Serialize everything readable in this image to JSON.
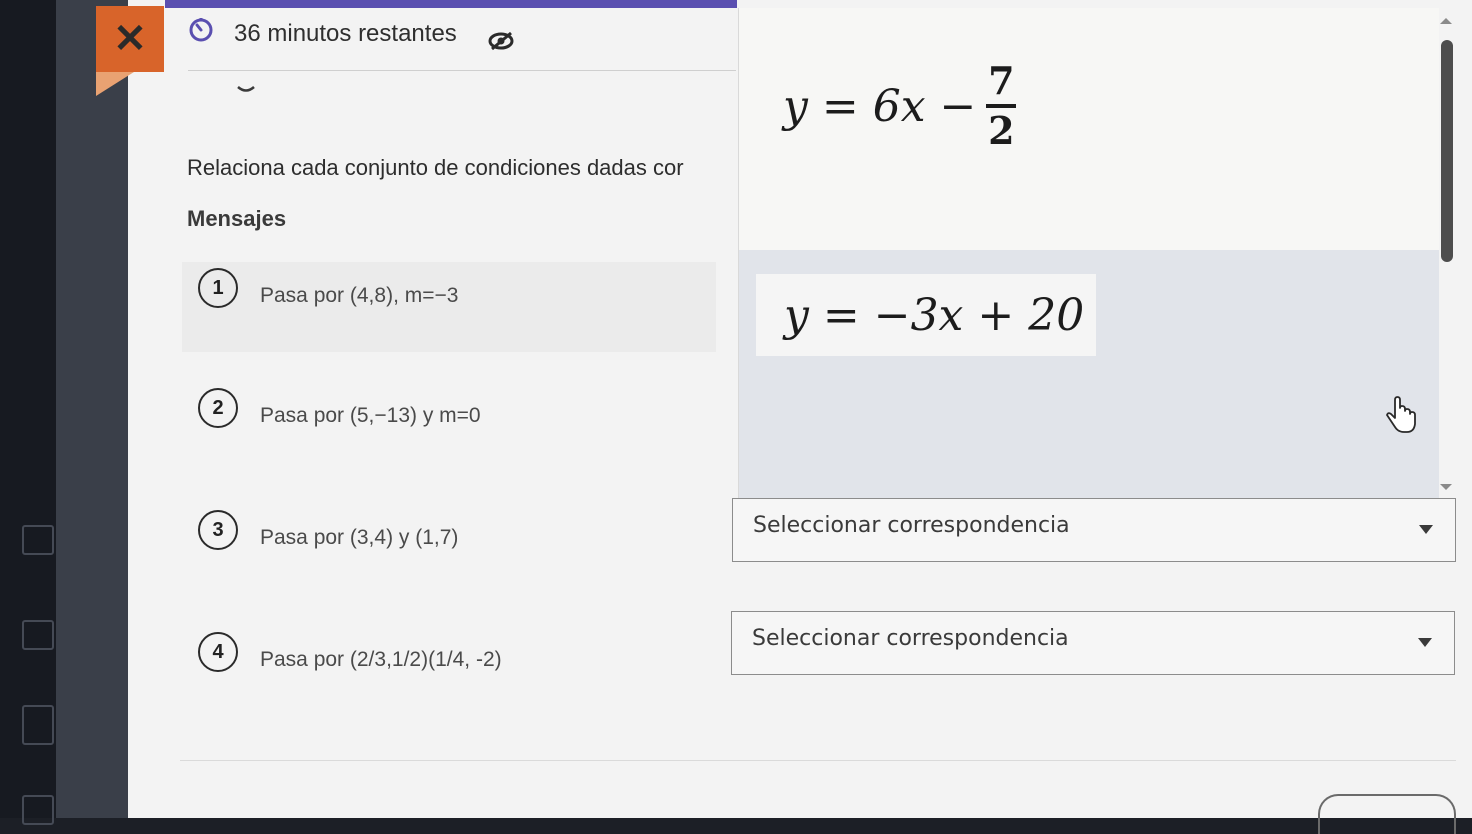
{
  "header": {
    "close_glyph": "✕",
    "timer_text": "36 minutos restantes",
    "progress_fraction": 1.0
  },
  "icons": {
    "timer": "timer-icon",
    "hide": "eye-slash-icon",
    "close": "close-icon",
    "collapse": "chevron-down-icon",
    "cursor": "hand-pointer-icon"
  },
  "question": {
    "instruction": "Relaciona cada conjunto de condiciones dadas cor",
    "section_label": "Mensajes",
    "items": [
      {
        "number": "1",
        "text": "Pasa por (4,8), m=−3"
      },
      {
        "number": "2",
        "text": "Pasa por (5,−13) y m=0"
      },
      {
        "number": "3",
        "text": "Pasa por (3,4) y (1,7)"
      },
      {
        "number": "4",
        "text": "Pasa por (2/3,1/2)(1/4, -2)"
      }
    ]
  },
  "options_panel": {
    "equation1": {
      "lhs": "y = 6x −",
      "numerator": "7",
      "denominator": "2"
    },
    "equation2": "y = −3x + 20"
  },
  "selects": [
    {
      "value": "Seleccionar correspondencia"
    },
    {
      "value": "Seleccionar correspondencia"
    }
  ],
  "colors": {
    "accent": "#d8642a",
    "progress": "#5a4fb0",
    "panel_highlight": "#e1e4ea"
  }
}
